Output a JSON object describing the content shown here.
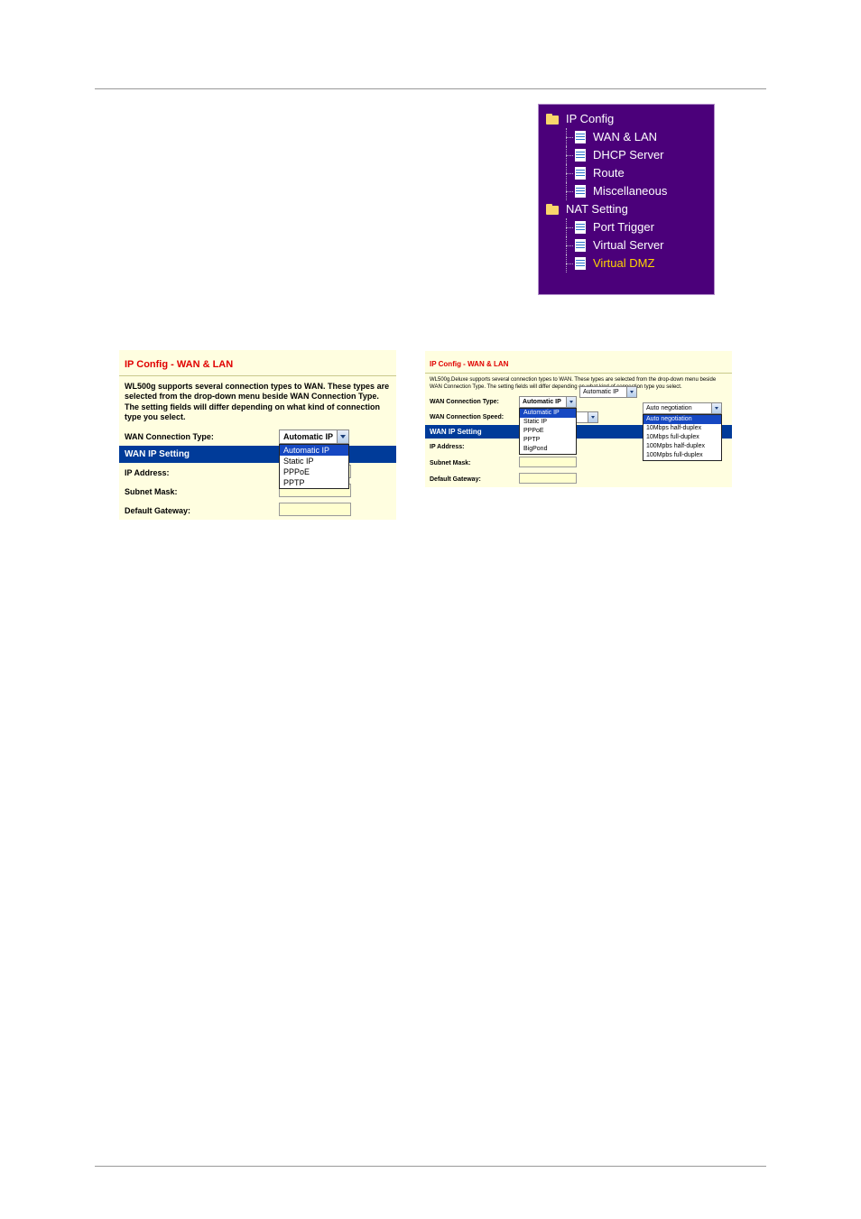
{
  "nav": {
    "items": [
      {
        "label": "IP Config",
        "type": "folder",
        "indent": 0,
        "selected": false
      },
      {
        "label": "WAN & LAN",
        "type": "file",
        "indent": 1,
        "selected": false
      },
      {
        "label": "DHCP Server",
        "type": "file",
        "indent": 1,
        "selected": false
      },
      {
        "label": "Route",
        "type": "file",
        "indent": 1,
        "selected": false
      },
      {
        "label": "Miscellaneous",
        "type": "file",
        "indent": 1,
        "selected": false
      },
      {
        "label": "NAT Setting",
        "type": "folder",
        "indent": 0,
        "selected": false
      },
      {
        "label": "Port Trigger",
        "type": "file",
        "indent": 1,
        "selected": false
      },
      {
        "label": "Virtual Server",
        "type": "file",
        "indent": 1,
        "selected": false
      },
      {
        "label": "Virtual DMZ",
        "type": "file",
        "indent": 1,
        "selected": true
      }
    ]
  },
  "panel_left": {
    "title": "IP Config - WAN & LAN",
    "desc": "WL500g supports several connection types to WAN. These types are selected from the drop-down menu beside WAN Connection Type. The setting fields will differ depending on what kind of connection type you select.",
    "labels": {
      "conn_type": "WAN Connection Type:",
      "wan_ip": "WAN IP Setting",
      "ip_addr": "IP Address:",
      "subnet": "Subnet Mask:",
      "gateway": "Default Gateway:"
    },
    "conn_type_select": {
      "value": "Automatic IP",
      "options": [
        "Automatic IP",
        "Static IP",
        "PPPoE",
        "PPTP"
      ]
    }
  },
  "panel_right": {
    "title": "IP Config - WAN & LAN",
    "desc": "WL500g.Deluxe supports several connection types to WAN. These types are selected from the drop-down menu beside WAN Connection Type. The setting fields will differ depending on what kind of connection type you select.",
    "labels": {
      "conn_type": "WAN Connection Type:",
      "conn_speed": "WAN Connection Speed:",
      "wan_ip": "WAN IP Setting",
      "ip_addr": "IP Address:",
      "subnet": "Subnet Mask:",
      "gateway": "Default Gateway:"
    },
    "conn_type_select": {
      "value": "Automatic IP",
      "options": [
        "Automatic IP",
        "Static IP",
        "PPPoE",
        "PPTP",
        "BigPond"
      ]
    },
    "conn_type_popout_value": "Automatic IP",
    "conn_speed_select": {
      "value": "Auto negotiation",
      "options": [
        "Auto negotiation",
        "10Mbps half-duplex",
        "10Mbps full-duplex",
        "100Mpbs half-duplex",
        "100Mpbs full-duplex"
      ]
    },
    "conn_speed_popout_value": "Auto negotiation"
  }
}
